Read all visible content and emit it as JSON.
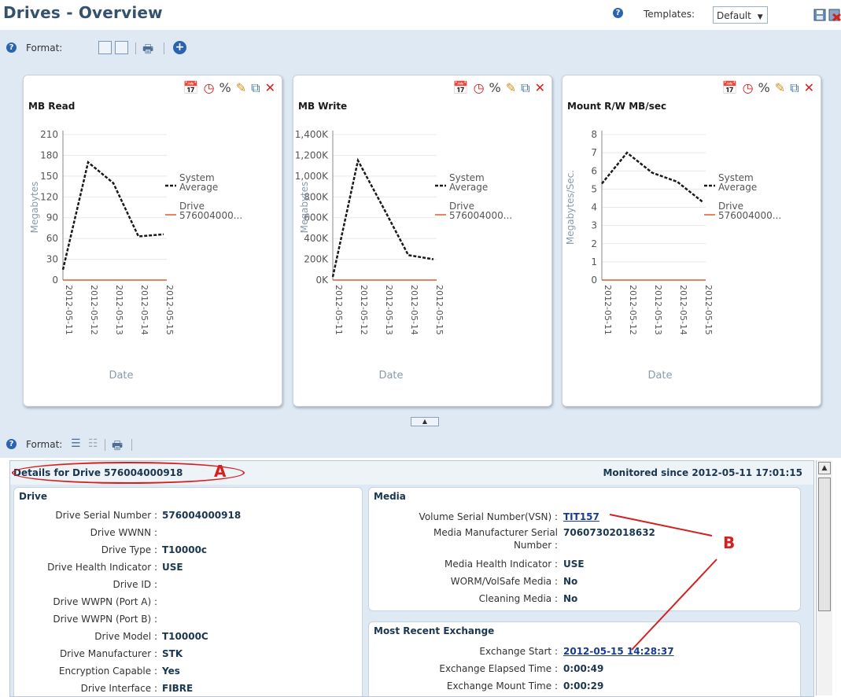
{
  "page": {
    "title": "Drives - Overview"
  },
  "header": {
    "templates_label": "Templates:",
    "template_value": "Default"
  },
  "toolbar1": {
    "format_label": "Format:"
  },
  "toolbar2": {
    "format_label": "Format:"
  },
  "chart_data": [
    {
      "type": "line",
      "title": "MB Read",
      "xlabel": "Date",
      "ylabel": "Megabytes",
      "categories": [
        "2012-05-11",
        "2012-05-12",
        "2012-05-13",
        "2012-05-14",
        "2012-05-15"
      ],
      "y_ticks": [
        "0",
        "30",
        "60",
        "90",
        "120",
        "150",
        "180",
        "210"
      ],
      "ylim": [
        0,
        210
      ],
      "series": [
        {
          "name": "System Average",
          "style": "dashed",
          "color": "#1a1a1a",
          "values": [
            15,
            170,
            140,
            63,
            66
          ]
        },
        {
          "name": "Drive 576004000...",
          "style": "solid",
          "color": "#e05a2a",
          "values": [
            0,
            0,
            0,
            0,
            0
          ]
        }
      ]
    },
    {
      "type": "line",
      "title": "MB Write",
      "xlabel": "Date",
      "ylabel": "Megabytes",
      "categories": [
        "2012-05-11",
        "2012-05-12",
        "2012-05-13",
        "2012-05-14",
        "2012-05-15"
      ],
      "y_ticks": [
        "0K",
        "200K",
        "400K",
        "600K",
        "800K",
        "1,000K",
        "1,200K",
        "1,400K"
      ],
      "ylim": [
        0,
        1400000
      ],
      "series": [
        {
          "name": "System Average",
          "style": "dashed",
          "color": "#1a1a1a",
          "values": [
            30000,
            1150000,
            700000,
            240000,
            200000
          ]
        },
        {
          "name": "Drive 576004000...",
          "style": "solid",
          "color": "#e05a2a",
          "values": [
            0,
            0,
            0,
            0,
            0
          ]
        }
      ]
    },
    {
      "type": "line",
      "title": "Mount R/W MB/sec",
      "xlabel": "Date",
      "ylabel": "Megabytes/Sec.",
      "categories": [
        "2012-05-11",
        "2012-05-12",
        "2012-05-13",
        "2012-05-14",
        "2012-05-15"
      ],
      "y_ticks": [
        "0",
        "1",
        "2",
        "3",
        "4",
        "5",
        "6",
        "7",
        "8"
      ],
      "ylim": [
        0,
        8
      ],
      "series": [
        {
          "name": "System Average",
          "style": "dashed",
          "color": "#1a1a1a",
          "values": [
            5.3,
            7.0,
            5.9,
            5.4,
            4.3
          ]
        },
        {
          "name": "Drive 576004000...",
          "style": "solid",
          "color": "#e05a2a",
          "values": [
            0,
            0,
            0,
            0,
            0
          ]
        }
      ]
    }
  ],
  "details": {
    "title": "Details for Drive 576004000918",
    "annotation_a": "A",
    "annotation_b": "B",
    "monitored": "Monitored since 2012-05-11 17:01:15",
    "drive": {
      "title": "Drive",
      "rows": [
        {
          "key": "Drive Serial Number :",
          "value": "576004000918"
        },
        {
          "key": "Drive WWNN :",
          "value": ""
        },
        {
          "key": "Drive Type :",
          "value": "T10000c"
        },
        {
          "key": "Drive Health Indicator :",
          "value": "USE"
        },
        {
          "key": "Drive ID :",
          "value": ""
        },
        {
          "key": "Drive WWPN (Port A) :",
          "value": ""
        },
        {
          "key": "Drive WWPN (Port B) :",
          "value": ""
        },
        {
          "key": "Drive Model :",
          "value": "T10000C"
        },
        {
          "key": "Drive Manufacturer :",
          "value": "STK"
        },
        {
          "key": "Encryption Capable :",
          "value": "Yes"
        },
        {
          "key": "Drive Interface :",
          "value": "FIBRE"
        }
      ]
    },
    "media": {
      "title": "Media",
      "vsn_key": "Volume Serial Number(VSN) :",
      "vsn_value": "TIT157",
      "mfr_key_1": "Media Manufacturer Serial",
      "mfr_key_2": "Number :",
      "mfr_value": "70607302018632",
      "health_key": "Media Health Indicator :",
      "health_value": "USE",
      "worm_key": "WORM/VolSafe Media :",
      "worm_value": "No",
      "clean_key": "Cleaning Media :",
      "clean_value": "No"
    },
    "exchange": {
      "title": "Most Recent Exchange",
      "start_key": "Exchange Start :",
      "start_value": "2012-05-15 14:28:37",
      "elapsed_key": "Exchange Elapsed Time :",
      "elapsed_value": "0:00:49",
      "mount_key": "Exchange Mount Time :",
      "mount_value": "0:00:29"
    }
  }
}
